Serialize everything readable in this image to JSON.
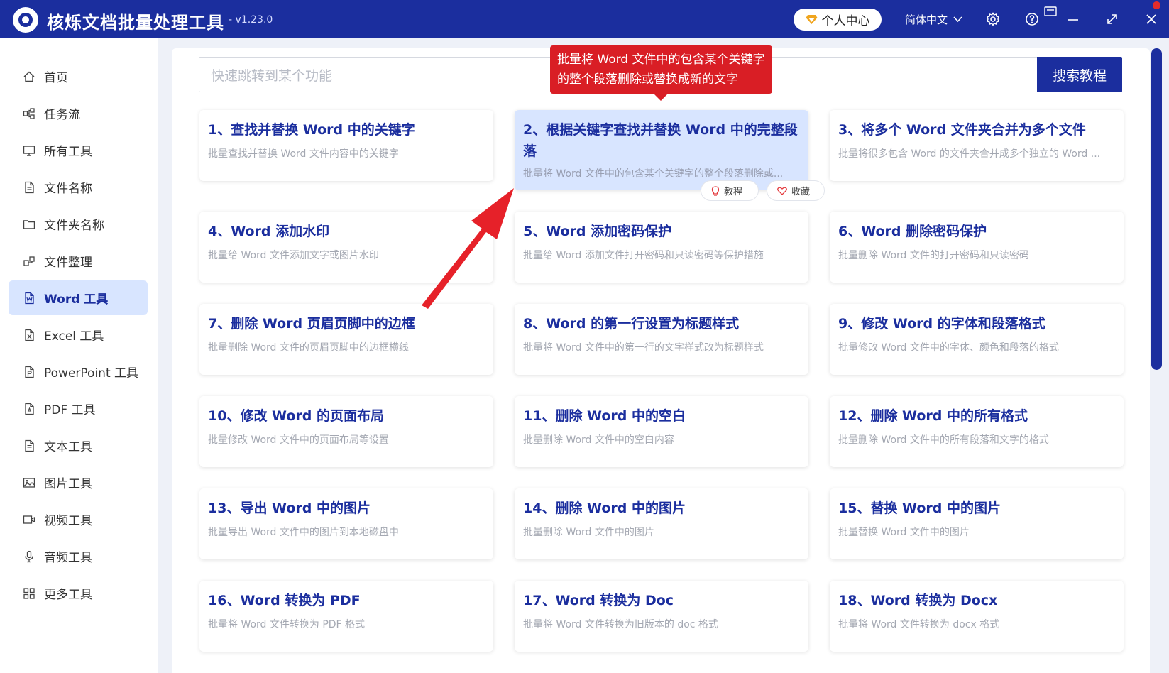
{
  "titlebar": {
    "title": "核烁文档批量处理工具",
    "version": "- v1.23.0",
    "user_center": "个人中心",
    "language": "简体中文",
    "settings_icon": "gear-icon",
    "help_icon": "help-icon",
    "skin_icon": "skin-icon",
    "minimize_icon": "minimize-icon",
    "maximize_icon": "maximize-icon",
    "close_icon": "close-icon"
  },
  "sidebar": {
    "items": [
      {
        "label": "首页",
        "icon": "home-icon"
      },
      {
        "label": "任务流",
        "icon": "workflow-icon"
      },
      {
        "label": "所有工具",
        "icon": "monitor-icon"
      },
      {
        "label": "文件名称",
        "icon": "file-icon"
      },
      {
        "label": "文件夹名称",
        "icon": "folder-icon"
      },
      {
        "label": "文件整理",
        "icon": "organize-icon"
      },
      {
        "label": "Word 工具",
        "icon": "word-icon"
      },
      {
        "label": "Excel 工具",
        "icon": "excel-icon"
      },
      {
        "label": "PowerPoint 工具",
        "icon": "powerpoint-icon"
      },
      {
        "label": "PDF 工具",
        "icon": "pdf-icon"
      },
      {
        "label": "文本工具",
        "icon": "text-icon"
      },
      {
        "label": "图片工具",
        "icon": "image-icon"
      },
      {
        "label": "视频工具",
        "icon": "video-icon"
      },
      {
        "label": "音频工具",
        "icon": "microphone-icon"
      },
      {
        "label": "更多工具",
        "icon": "grid-icon"
      }
    ],
    "active_index": 6
  },
  "search": {
    "placeholder": "快速跳转到某个功能",
    "button": "搜索教程"
  },
  "tooltip": {
    "text": "批量将 Word 文件中的包含某个关键字的整个段落删除或替换成新的文字"
  },
  "cards": [
    {
      "title": "1、查找并替换 Word 中的关键字",
      "desc": "批量查找并替换 Word 文件内容中的关键字"
    },
    {
      "title": "2、根据关键字查找并替换 Word 中的完整段落",
      "desc": "批量将 Word 文件中的包含某个关键字的整个段落删除或..."
    },
    {
      "title": "3、将多个 Word 文件夹合并为多个文件",
      "desc": "批量将很多包含 Word 的文件夹合并成多个独立的 Word ..."
    },
    {
      "title": "4、Word 添加水印",
      "desc": "批量给 Word 文件添加文字或图片水印"
    },
    {
      "title": "5、Word 添加密码保护",
      "desc": "批量给 Word 添加文件打开密码和只读密码等保护措施"
    },
    {
      "title": "6、Word 删除密码保护",
      "desc": "批量删除 Word 文件的打开密码和只读密码"
    },
    {
      "title": "7、删除 Word 页眉页脚中的边框",
      "desc": "批量删除 Word 文件的页眉页脚中的边框横线"
    },
    {
      "title": "8、Word 的第一行设置为标题样式",
      "desc": "批量将 Word 文件中的第一行的文字样式改为标题样式"
    },
    {
      "title": "9、修改 Word 的字体和段落格式",
      "desc": "批量修改 Word 文件中的字体、颜色和段落的格式"
    },
    {
      "title": "10、修改 Word 的页面布局",
      "desc": "批量修改 Word 文件中的页面布局等设置"
    },
    {
      "title": "11、删除 Word 中的空白",
      "desc": "批量删除 Word 文件中的空白内容"
    },
    {
      "title": "12、删除 Word 中的所有格式",
      "desc": "批量删除 Word 文件中的所有段落和文字的格式"
    },
    {
      "title": "13、导出 Word 中的图片",
      "desc": "批量导出 Word 文件中的图片到本地磁盘中"
    },
    {
      "title": "14、删除 Word 中的图片",
      "desc": "批量删除 Word 文件中的图片"
    },
    {
      "title": "15、替换 Word 中的图片",
      "desc": "批量替换 Word 文件中的图片"
    },
    {
      "title": "16、Word 转换为 PDF",
      "desc": "批量将 Word 文件转换为 PDF 格式"
    },
    {
      "title": "17、Word 转换为 Doc",
      "desc": "批量将 Word 文件转换为旧版本的 doc 格式"
    },
    {
      "title": "18、Word 转换为 Docx",
      "desc": "批量将 Word 文件转换为 docx 格式"
    }
  ],
  "card_actions": {
    "tutorial": "教程",
    "favorite": "收藏"
  },
  "colors": {
    "brand": "#1b2e9e",
    "highlight": "#d8e5ff",
    "tooltip": "#d91e25",
    "arrow": "#e62129"
  }
}
